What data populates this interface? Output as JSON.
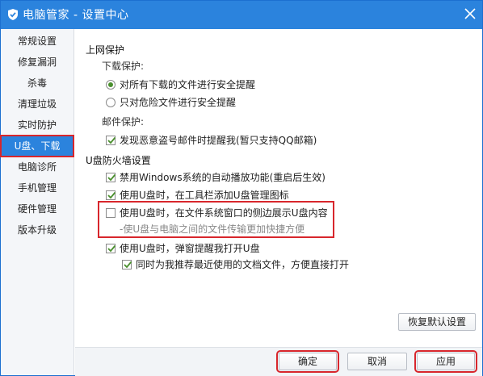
{
  "window": {
    "title": "电脑管家 - 设置中心",
    "close_icon": "close-icon",
    "logo_icon": "shield-logo-icon"
  },
  "sidebar": {
    "items": [
      {
        "label": "常规设置"
      },
      {
        "label": "修复漏洞"
      },
      {
        "label": "杀毒"
      },
      {
        "label": "清理垃圾"
      },
      {
        "label": "实时防护"
      },
      {
        "label": "U盘、下载",
        "active": true
      },
      {
        "label": "电脑诊所"
      },
      {
        "label": "手机管理"
      },
      {
        "label": "硬件管理"
      },
      {
        "label": "版本升级"
      }
    ]
  },
  "main": {
    "web_protection": {
      "title": "上网保护",
      "download_label": "下载保护:",
      "radio_all": {
        "label": "对所有下载的文件进行安全提醒",
        "selected": true
      },
      "radio_danger": {
        "label": "只对危险文件进行安全提醒",
        "selected": false
      },
      "mail_label": "邮件保护:",
      "mail_check": {
        "label": "发现恶意盗号邮件时提醒我(暂只支持QQ邮箱)",
        "checked": true
      }
    },
    "usb_firewall": {
      "title": "U盘防火墙设置",
      "disable_autoplay": {
        "label": "禁用Windows系统的自动播放功能(重启后生效)",
        "checked": true
      },
      "toolbar_icon": {
        "label": "使用U盘时，在工具栏添加U盘管理图标",
        "checked": true
      },
      "sidebar_show": {
        "label": "使用U盘时，在文件系统窗口的侧边展示U盘内容",
        "checked": false
      },
      "sidebar_hint": "-使U盘与电脑之间的文件传输更加快捷方便",
      "popup_open": {
        "label": "使用U盘时，弹窗提醒我打开U盘",
        "checked": true
      },
      "recommend_docs": {
        "label": "同时为我推荐最近使用的文档文件，方便直接打开",
        "checked": true
      }
    },
    "restore_default": "恢复默认设置"
  },
  "footer": {
    "ok": "确定",
    "cancel": "取消",
    "apply": "应用"
  },
  "colors": {
    "accent": "#2b83dd",
    "highlight": "#d8262c",
    "check": "#4a8f2e"
  }
}
